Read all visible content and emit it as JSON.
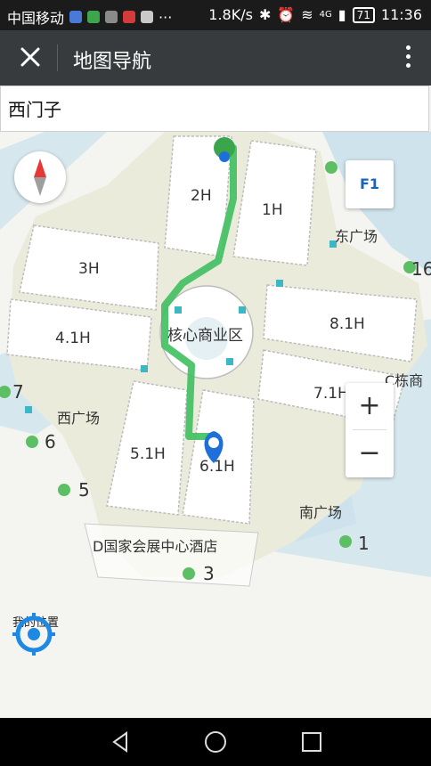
{
  "status_bar": {
    "carrier": "中国移动",
    "dots": "···",
    "speed": "1.8K/s",
    "network": "4G",
    "battery": "71",
    "time": "11:36"
  },
  "app_bar": {
    "title": "地图导航"
  },
  "search": {
    "value": "西门子"
  },
  "map": {
    "floor": "F1",
    "halls": [
      "2H",
      "1H",
      "3H",
      "8.1H",
      "4.1H",
      "7.1H",
      "5.1H",
      "6.1H"
    ],
    "center": "核心商业区",
    "plazas": {
      "east": "东广场",
      "west": "西广场",
      "south": "南广场"
    },
    "hotel": "D国家会展中心酒店",
    "c_building": "C栋商",
    "gates": [
      "16",
      "7",
      "6",
      "5",
      "1",
      "3"
    ]
  },
  "controls": {
    "zoom_in": "+",
    "zoom_out": "−",
    "my_location": "我的位置"
  },
  "colors": {
    "route": "#3fbf5f",
    "marker": "#1e6fd9",
    "app_bar": "#373b3e"
  }
}
